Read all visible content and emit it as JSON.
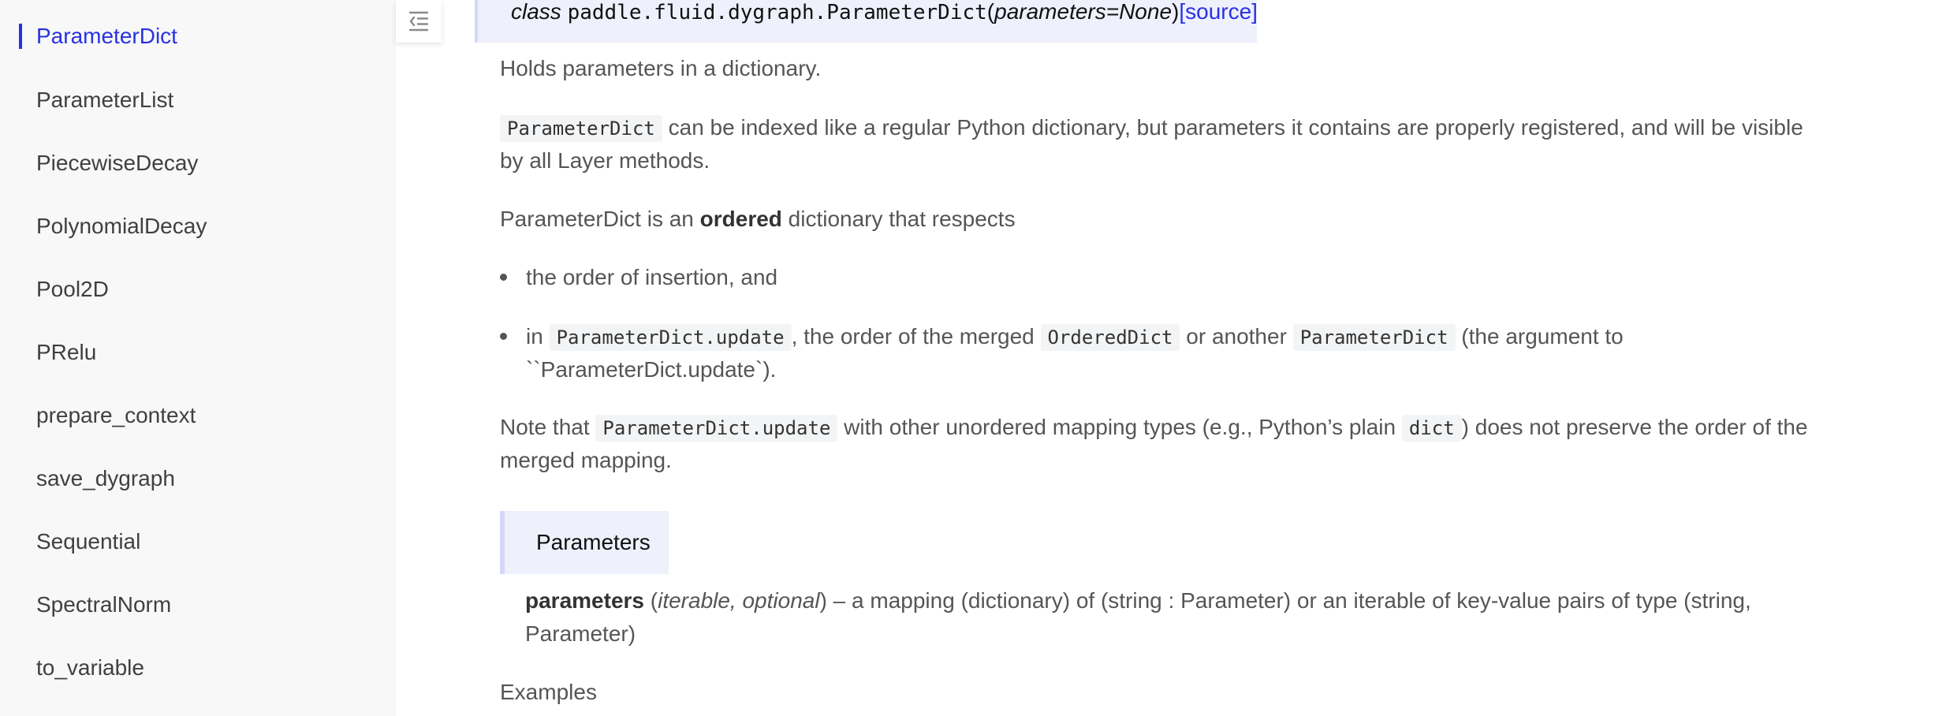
{
  "sidebar": {
    "items": [
      {
        "label": "ParameterDict",
        "active": true
      },
      {
        "label": "ParameterList",
        "active": false
      },
      {
        "label": "PiecewiseDecay",
        "active": false
      },
      {
        "label": "PolynomialDecay",
        "active": false
      },
      {
        "label": "Pool2D",
        "active": false
      },
      {
        "label": "PRelu",
        "active": false
      },
      {
        "label": "prepare_context",
        "active": false
      },
      {
        "label": "save_dygraph",
        "active": false
      },
      {
        "label": "Sequential",
        "active": false
      },
      {
        "label": "SpectralNorm",
        "active": false
      },
      {
        "label": "to_variable",
        "active": false
      }
    ]
  },
  "toc_toggle": {
    "icon": "outdent-icon"
  },
  "signature": {
    "keyword": "class",
    "name": "paddle.fluid.dygraph.ParameterDict",
    "open_paren": "(",
    "params": "parameters=None",
    "close_paren": ")",
    "source_link": "[source]"
  },
  "doc": {
    "summary": "Holds parameters in a dictionary.",
    "p1": {
      "code": "ParameterDict",
      "line1_rest": " can be indexed like a regular Python dictionary, but parameters it contains are properly registered, and will be visible",
      "line2": "by all Layer methods."
    },
    "p2": {
      "pre": "ParameterDict is an ",
      "bold": "ordered",
      "post": " dictionary that respects"
    },
    "bullet1": "the order of insertion, and",
    "bullet2": {
      "pre": "in ",
      "code1": "ParameterDict.update",
      "mid1": ", the order of the merged ",
      "code2": "OrderedDict",
      "mid2": " or another ",
      "code3": "ParameterDict",
      "post": " (the argument to",
      "line2": "``ParameterDict.update`)."
    },
    "note": {
      "pre": "Note that ",
      "code1": "ParameterDict.update",
      "mid": " with other unordered mapping types (e.g., Python’s plain ",
      "code2": "dict",
      "post": ") does not preserve the order of the",
      "line2": "merged mapping."
    },
    "parameters_header": "Parameters",
    "param": {
      "name": "parameters",
      "open": " (",
      "type": "iterable, optional",
      "desc": ") – a mapping (dictionary) of (string : Parameter) or an iterable of key-value pairs of type (string,",
      "line2": "Parameter)"
    },
    "examples_label": "Examples"
  },
  "colors": {
    "accent": "#2932e1",
    "sidebar_bg": "#f8f8f9",
    "sig_bg": "#eef0fc",
    "text": "#555555"
  }
}
